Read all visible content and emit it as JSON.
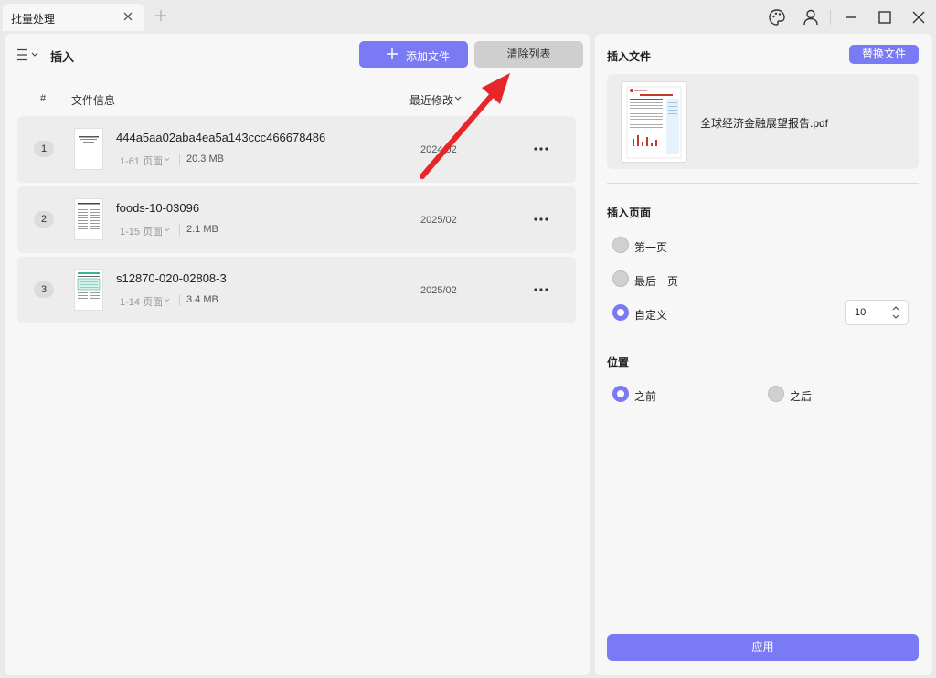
{
  "titlebar": {
    "tab_title": "批量处理",
    "icons": [
      "close-icon",
      "plus-icon",
      "palette-icon",
      "user-icon",
      "minimize-icon",
      "maximize-icon",
      "close-window-icon"
    ]
  },
  "left": {
    "title": "插入",
    "add_button": "添加文件",
    "clear_button": "清除列表",
    "columns": {
      "hash": "#",
      "info": "文件信息",
      "modified": "最近修改"
    },
    "files": [
      {
        "index": "1",
        "name": "444a5aa02aba4ea5a143ccc466678486",
        "pages": "1-61 页面",
        "size": "20.3 MB",
        "date": "2024/02"
      },
      {
        "index": "2",
        "name": "foods-10-03096",
        "pages": "1-15 页面",
        "size": "2.1 MB",
        "date": "2025/02"
      },
      {
        "index": "3",
        "name": "s12870-020-02808-3",
        "pages": "1-14 页面",
        "size": "3.4 MB",
        "date": "2025/02"
      }
    ]
  },
  "right": {
    "title": "插入文件",
    "replace_button": "替换文件",
    "file_name": "全球经济金融展望报告.pdf",
    "insert_pages_label": "插入页面",
    "page_options": [
      {
        "label": "第一页",
        "selected": false
      },
      {
        "label": "最后一页",
        "selected": false
      },
      {
        "label": "自定义",
        "selected": true
      }
    ],
    "custom_page_value": "10",
    "position_label": "位置",
    "position_options": [
      {
        "label": "之前",
        "selected": true
      },
      {
        "label": "之后",
        "selected": false
      }
    ],
    "apply_button": "应用"
  },
  "colors": {
    "accent": "#7b7af5",
    "annotation": "#e5262b"
  }
}
